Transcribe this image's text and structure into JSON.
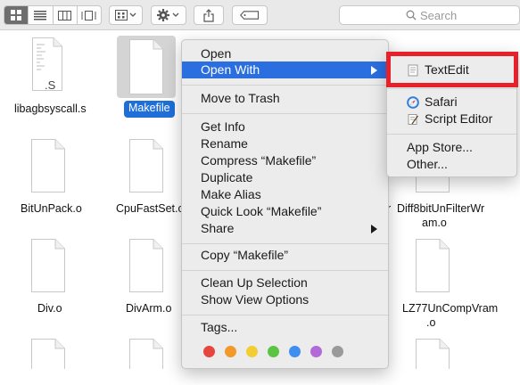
{
  "toolbar": {
    "view_icon_label": "icon-view",
    "search_placeholder": "Search"
  },
  "files": {
    "libagbsyscall": "libagbsyscall.s",
    "makefile": "Makefile",
    "bitunpack": "BitUnPack.o",
    "cpufastset": "CpuFastSet.o",
    "diff8bit_line1": "Diff8bitUnFilterWr",
    "diff8bit_line2": "am.o",
    "div": "Div.o",
    "divarm": "DivArm.o",
    "lz77_line1": "LZ77UnCompVram",
    "lz77_line2": ".o",
    "partial_right": "r",
    "s_ext": ".S"
  },
  "context_menu": {
    "open": "Open",
    "open_with": "Open With",
    "move_to_trash": "Move to Trash",
    "get_info": "Get Info",
    "rename": "Rename",
    "compress": "Compress “Makefile”",
    "duplicate": "Duplicate",
    "make_alias": "Make Alias",
    "quick_look": "Quick Look “Makefile”",
    "share": "Share",
    "copy": "Copy “Makefile”",
    "clean_up": "Clean Up Selection",
    "show_view_options": "Show View Options",
    "tags": "Tags...",
    "tag_colors": [
      "#e5463d",
      "#f19a2b",
      "#f2cd33",
      "#5dc443",
      "#3f8ef0",
      "#b36ad9",
      "#9a9a9a"
    ]
  },
  "submenu": {
    "textedit": "TextEdit",
    "safari": "Safari",
    "script_editor": "Script Editor",
    "app_store": "App Store...",
    "other": "Other..."
  },
  "colors": {
    "highlight": "#2b6ee0",
    "selection_label": "#1f6fd8",
    "annotation_box": "#e8202a"
  }
}
